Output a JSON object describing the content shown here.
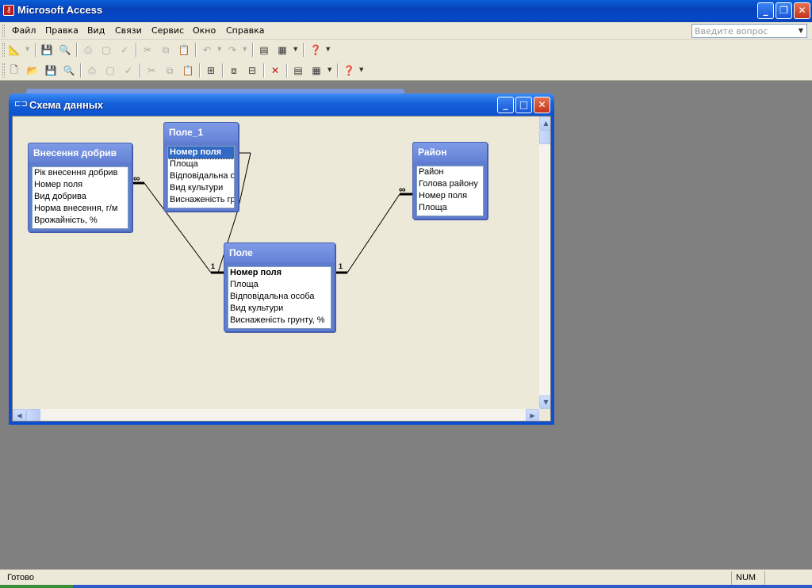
{
  "app": {
    "title": "Microsoft Access",
    "icon": "access-key-icon"
  },
  "menubar": {
    "items": [
      "Файл",
      "Правка",
      "Вид",
      "Связи",
      "Сервис",
      "Окно",
      "Справка"
    ],
    "underline": [
      "Ф",
      "П",
      "В",
      "С",
      "С",
      "О",
      "С"
    ],
    "ask_placeholder": "Введите вопрос"
  },
  "toolbar1": {
    "icons": [
      "design-view-icon",
      "save-icon",
      "print-preview-icon",
      "print-icon",
      "preview-icon",
      "spelling-icon",
      "cut-icon",
      "copy-icon",
      "paste-icon",
      "undo-icon",
      "redo-icon",
      "office-links-icon",
      "analyze-icon",
      "help-icon"
    ]
  },
  "toolbar2": {
    "icons": [
      "new-icon",
      "open-icon",
      "save-icon",
      "file-search-icon",
      "print-icon",
      "print-preview-icon",
      "spelling-icon",
      "cut-icon",
      "copy-icon",
      "paste-icon",
      "show-table-icon",
      "direct-relationships-icon",
      "all-relationships-icon",
      "delete-icon",
      "database-window-icon",
      "new-object-icon",
      "help-icon"
    ]
  },
  "schema_window": {
    "title": "Схема данных",
    "tables": {
      "vnesennia": {
        "title": "Внесення добрив",
        "fields": [
          "Рік внесення добрив",
          "Номер поля",
          "Вид добрива",
          "Норма внесення, г/м",
          "Врожайність, %"
        ]
      },
      "pole1": {
        "title": "Поле_1",
        "fields": [
          "Номер поля",
          "Площа",
          "Відповідальна ос",
          "Вид культури",
          "Виснаженість гр"
        ]
      },
      "raion": {
        "title": "Район",
        "fields": [
          "Район",
          "Голова району",
          "Номер поля",
          "Площа"
        ]
      },
      "pole": {
        "title": "Поле",
        "fields": [
          "Номер поля",
          "Площа",
          "Відповідальна особа",
          "Вид культури",
          "Виснаженість грунту, %"
        ]
      }
    },
    "relations": {
      "many_symbol": "∞",
      "one_symbol": "1"
    }
  },
  "statusbar": {
    "text": "Готово",
    "num": "NUM"
  }
}
